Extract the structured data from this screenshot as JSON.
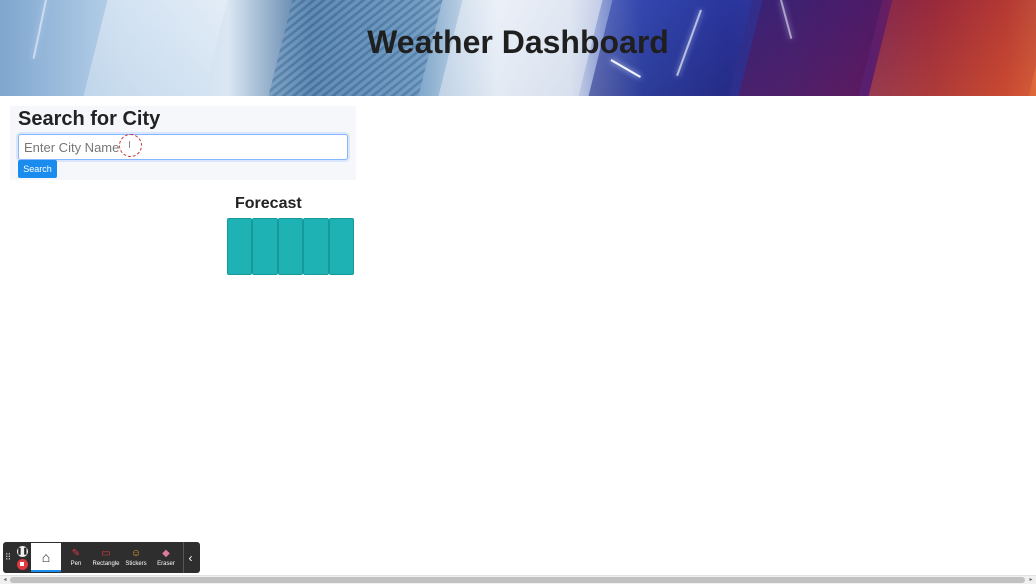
{
  "header": {
    "title": "Weather Dashboard"
  },
  "search": {
    "heading": "Search for City",
    "input_placeholder": "Enter City Name",
    "input_value": "",
    "button_label": "Search"
  },
  "forecast": {
    "heading": "Forecast",
    "cards": [
      "",
      "",
      "",
      "",
      ""
    ],
    "card_color": "#1fb2b5"
  },
  "toolbar": {
    "tools": [
      {
        "label": "Pen",
        "icon": "pen-icon"
      },
      {
        "label": "Rectangle",
        "icon": "rectangle-icon"
      },
      {
        "label": "Stickers",
        "icon": "stickers-icon"
      },
      {
        "label": "Eraser",
        "icon": "eraser-icon"
      }
    ]
  },
  "colors": {
    "accent": "#1a8cf0",
    "focus_border": "#86b7fe"
  }
}
